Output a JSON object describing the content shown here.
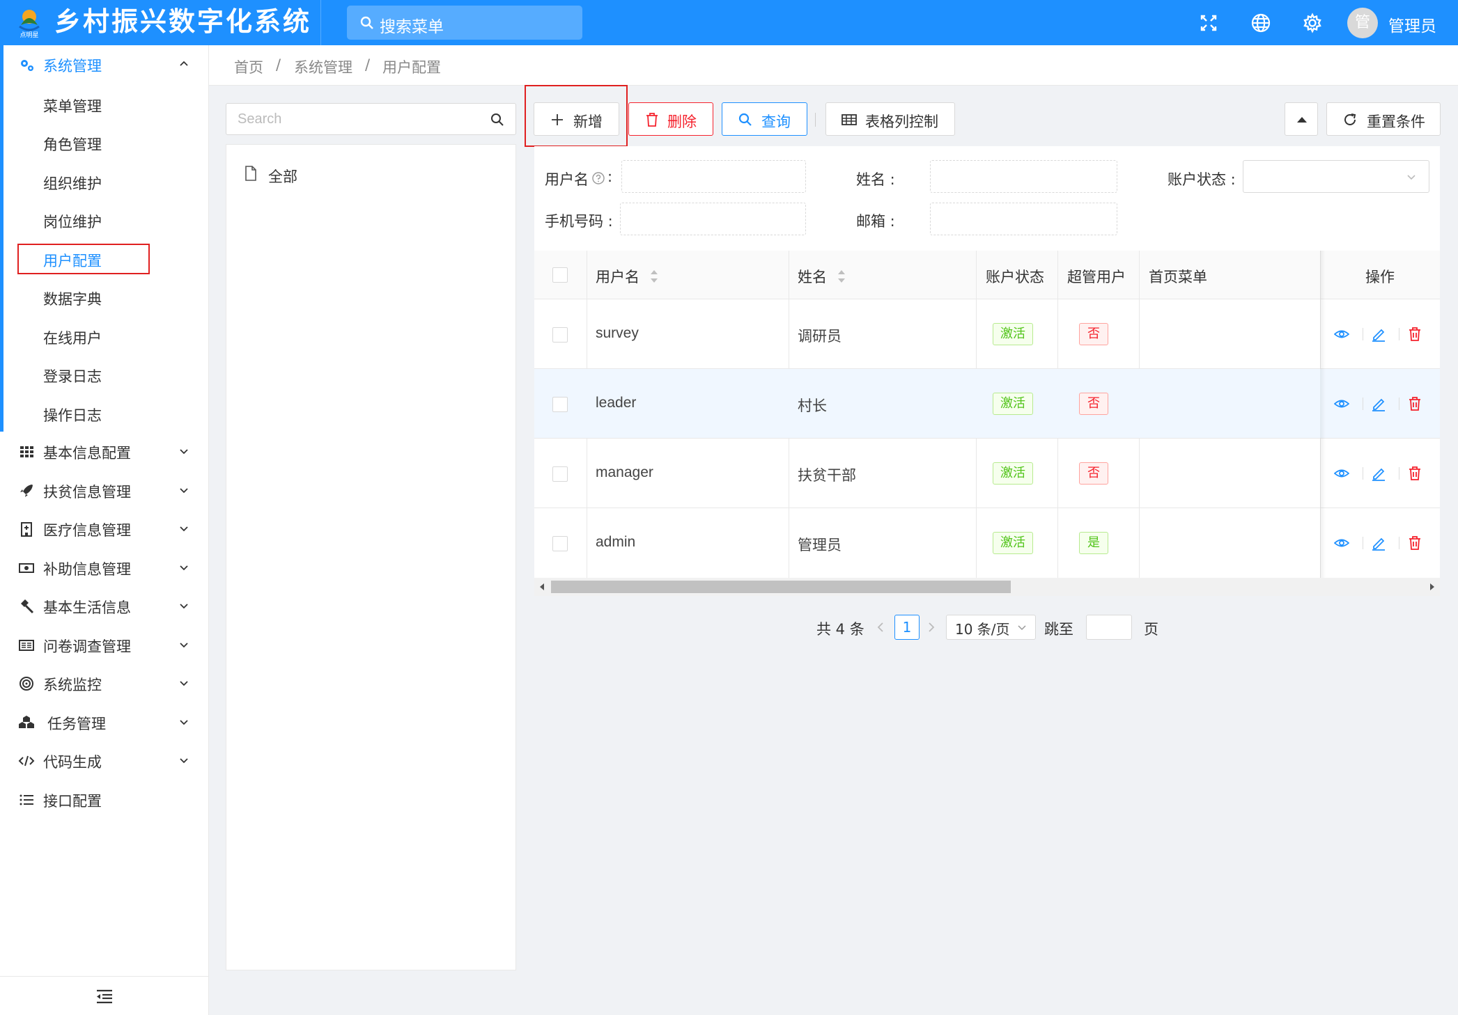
{
  "app": {
    "title": "乡村振兴数字化系统",
    "logo_text": "点明星"
  },
  "header": {
    "search_placeholder": "搜索菜单",
    "avatar_char": "管",
    "user_name": "管理员"
  },
  "sidebar": {
    "groups": [
      {
        "label": "系统管理",
        "expanded": true
      },
      {
        "label": "基本信息配置"
      },
      {
        "label": "扶贫信息管理"
      },
      {
        "label": "医疗信息管理"
      },
      {
        "label": "补助信息管理"
      },
      {
        "label": "基本生活信息"
      },
      {
        "label": "问卷调查管理"
      },
      {
        "label": "系统监控"
      },
      {
        "label": "任务管理"
      },
      {
        "label": "代码生成"
      },
      {
        "label": "接口配置"
      }
    ],
    "sub_items": [
      "菜单管理",
      "角色管理",
      "组织维护",
      "岗位维护",
      "用户配置",
      "数据字典",
      "在线用户",
      "登录日志",
      "操作日志"
    ],
    "active_sub": "用户配置"
  },
  "breadcrumb": {
    "home": "首页",
    "section": "系统管理",
    "current": "用户配置",
    "sep": "/"
  },
  "tree": {
    "search_placeholder": "Search",
    "root": "全部"
  },
  "toolbar": {
    "add": "新增",
    "delete": "删除",
    "query": "查询",
    "columns": "表格列控制",
    "reset": "重置条件"
  },
  "filter": {
    "username_label": "用户名",
    "colon": ":",
    "name_label": "姓名 :",
    "status_label": "账户状态 :",
    "phone_label": "手机号码 :",
    "email_label": "邮箱 :"
  },
  "table": {
    "headers": {
      "username": "用户名",
      "name": "姓名",
      "status": "账户状态",
      "super": "超管用户",
      "home_menu": "首页菜单",
      "actions": "操作"
    },
    "rows": [
      {
        "username": "survey",
        "name": "调研员",
        "status": "激活",
        "super": "否"
      },
      {
        "username": "leader",
        "name": "村长",
        "status": "激活",
        "super": "否"
      },
      {
        "username": "manager",
        "name": "扶贫干部",
        "status": "激活",
        "super": "否"
      },
      {
        "username": "admin",
        "name": "管理员",
        "status": "激活",
        "super": "是"
      }
    ]
  },
  "pagination": {
    "total": "共 4 条",
    "current_page": "1",
    "page_size": "10 条/页",
    "jump_label": "跳至",
    "page_suffix": "页"
  },
  "colors": {
    "primary": "#1e90ff",
    "danger": "#f5222d",
    "success": "#52c41a",
    "highlight_box": "#e02020"
  }
}
